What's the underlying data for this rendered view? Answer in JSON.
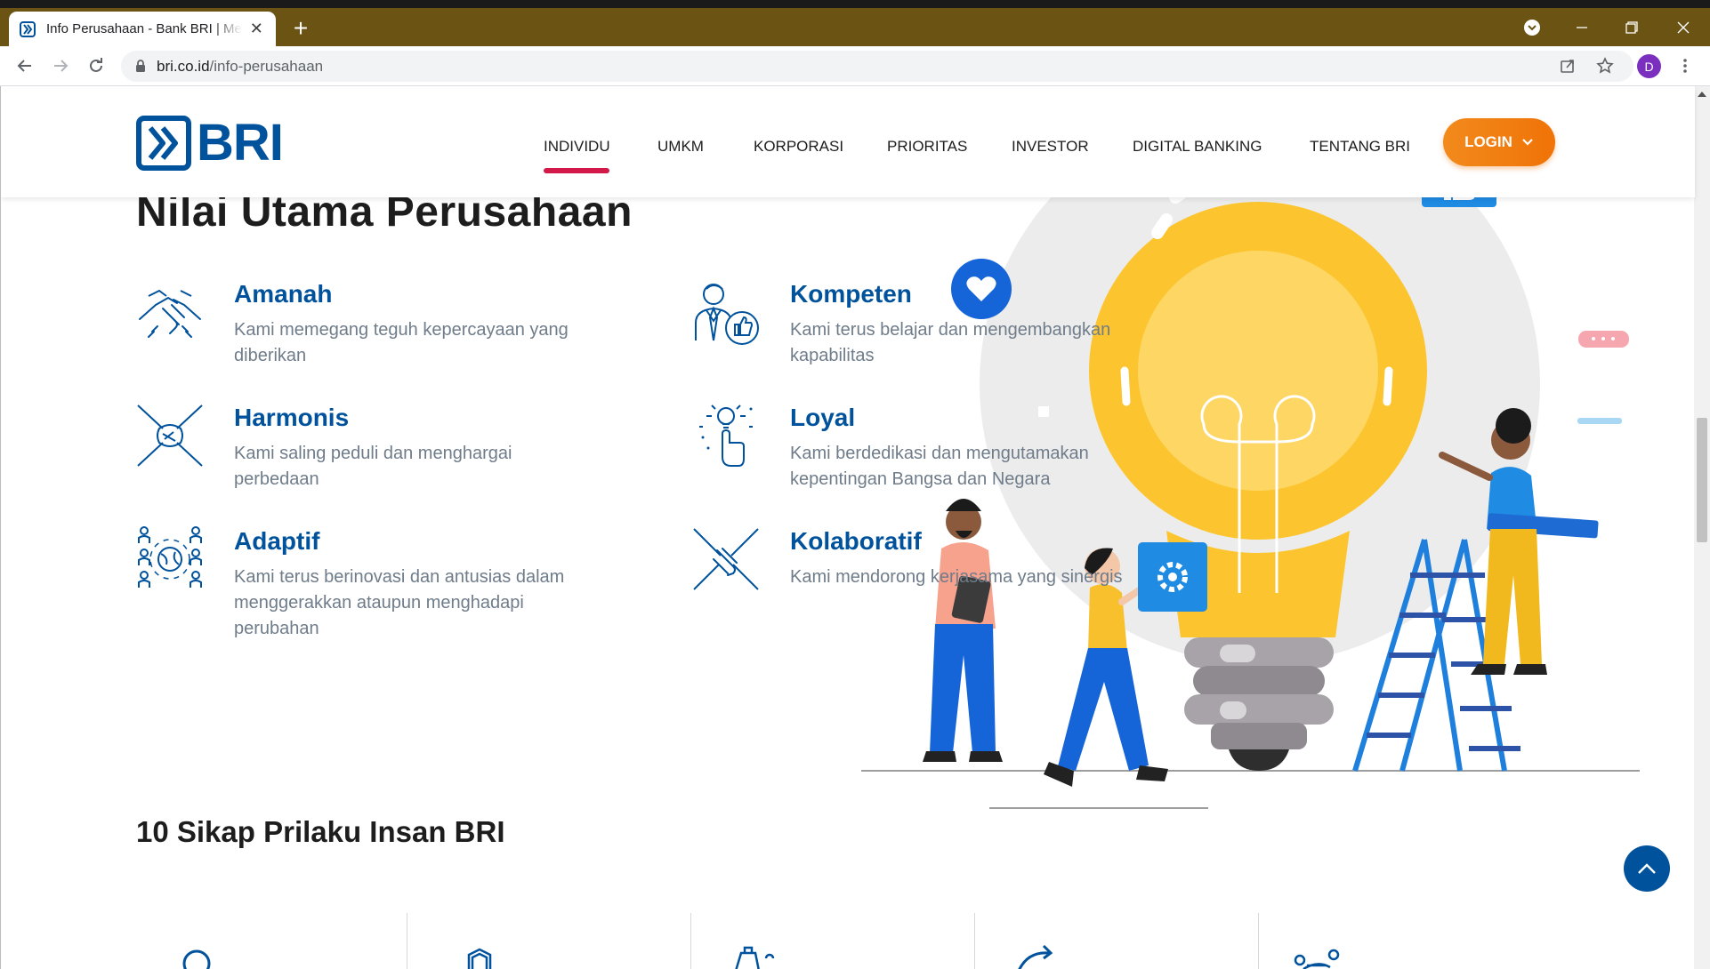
{
  "browser": {
    "tab_title": "Info Perusahaan - Bank BRI | Melayani Dengan Setulus Hati",
    "url_domain": "bri.co.id",
    "url_path": "/info-perusahaan",
    "profile_initial": "D"
  },
  "site": {
    "logo_text": "BRI",
    "nav": {
      "individu": "INDIVIDU",
      "umkm": "UMKM",
      "korporasi": "KORPORASI",
      "prioritas": "PRIORITAS",
      "investor": "INVESTOR",
      "digital_banking": "DIGITAL BANKING",
      "tentang_bri": "TENTANG BRI"
    },
    "login_label": "LOGIN"
  },
  "values_section": {
    "title": "Nilai Utama Perusahaan",
    "items": [
      {
        "title": "Amanah",
        "desc": "Kami memegang teguh kepercayaan yang diberikan",
        "icon": "handshake-icon"
      },
      {
        "title": "Kompeten",
        "desc": "Kami terus belajar dan mengembangkan kapabilitas",
        "icon": "professional-thumbs-up-icon"
      },
      {
        "title": "Harmonis",
        "desc": "Kami saling peduli dan menghargai perbedaan",
        "icon": "joined-hands-icon"
      },
      {
        "title": "Loyal",
        "desc": "Kami berdedikasi dan mengutamakan kepentingan Bangsa dan Negara",
        "icon": "idea-hand-icon"
      },
      {
        "title": "Adaptif",
        "desc": "Kami terus berinovasi dan antusias dalam menggerakkan ataupun menghadapi perubahan",
        "icon": "global-people-icon"
      },
      {
        "title": "Kolaboratif",
        "desc": "Kami mendorong kerjasama yang sinergis",
        "icon": "collaboration-hands-icon"
      }
    ]
  },
  "sikap_section": {
    "title": "10 Sikap Prilaku Insan BRI"
  },
  "colors": {
    "brand_blue": "#00529c",
    "accent_red": "#d3184a",
    "login_orange": "#f07307",
    "tab_bar": "#6b5313"
  }
}
